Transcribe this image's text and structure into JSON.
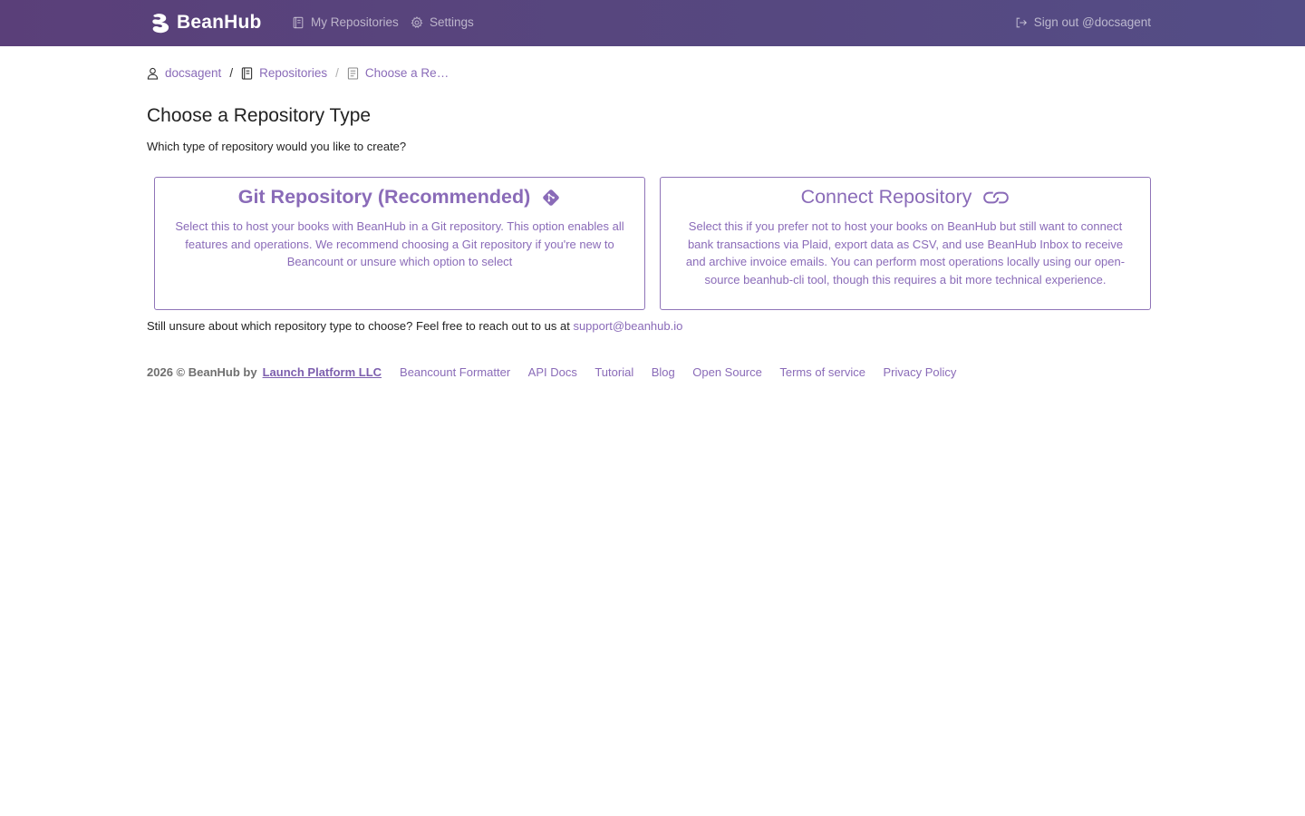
{
  "colors": {
    "accent": "#8a6bb8",
    "navbar_start": "#5a3f79",
    "navbar_end": "#544d86",
    "card_border": "#8f74b8"
  },
  "navbar": {
    "brand": "BeanHub",
    "links": [
      {
        "label": "My Repositories",
        "icon": "repository-icon"
      },
      {
        "label": "Settings",
        "icon": "gear-icon"
      }
    ],
    "signout": {
      "label": "Sign out @docsagent",
      "icon": "sign-out-icon"
    }
  },
  "breadcrumb": [
    {
      "label": "docsagent",
      "icon": "user-icon"
    },
    {
      "label": "Repositories",
      "icon": "repository-icon"
    },
    {
      "label": "Choose a Re…",
      "icon": "repository-template-icon"
    }
  ],
  "main": {
    "title": "Choose a Repository Type",
    "subtitle": "Which type of repository would you like to create?",
    "cards": [
      {
        "title": "Git Repository (Recommended)",
        "icon": "git-icon",
        "description": "Select this to host your books with BeanHub in a Git repository. This option enables all features and operations. We recommend choosing a Git repository if you're new to Beancount or unsure which option to select"
      },
      {
        "title": "Connect Repository",
        "icon": "link-icon",
        "description": "Select this if you prefer not to host your books on BeanHub but still want to connect bank transactions via Plaid, export data as CSV, and use BeanHub Inbox to receive and archive invoice emails. You can perform most operations locally using our open-source beanhub-cli tool, though this requires a bit more technical experience."
      }
    ],
    "help_text": "Still unsure about which repository type to choose? Feel free to reach out to us at",
    "support_email": "support@beanhub.io"
  },
  "footer": {
    "copyright": "2026 © BeanHub by",
    "company": "Launch Platform LLC",
    "links": [
      "Beancount Formatter",
      "API Docs",
      "Tutorial",
      "Blog",
      "Open Source",
      "Terms of service",
      "Privacy Policy"
    ]
  }
}
